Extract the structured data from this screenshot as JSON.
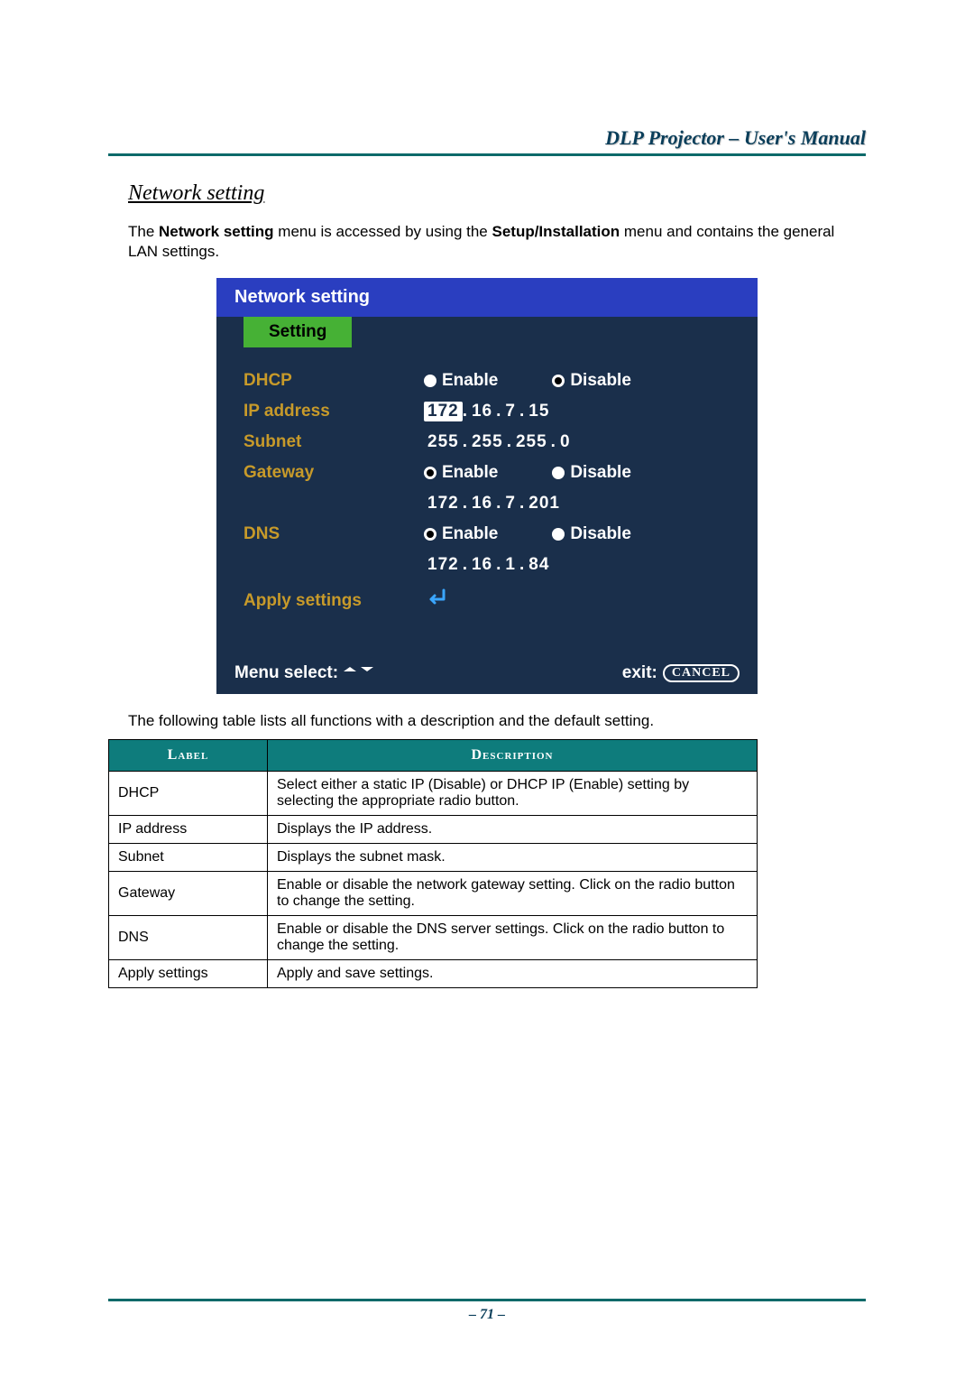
{
  "header": {
    "title": "DLP Projector – User's Manual"
  },
  "section": {
    "heading": "Network setting",
    "intro_pre": "The ",
    "intro_b1": "Network setting",
    "intro_mid": " menu is accessed by using the ",
    "intro_b2": "Setup/Installation",
    "intro_post": " menu and contains the general LAN settings."
  },
  "osd": {
    "title": "Network setting",
    "tab": "Setting",
    "rows": {
      "dhcp": {
        "label": "DHCP",
        "enable": "Enable",
        "disable": "Disable",
        "selected": "disable"
      },
      "ip": {
        "label": "IP address",
        "octets": [
          "172",
          "16",
          "7",
          "15"
        ],
        "highlight_index": 0
      },
      "subnet": {
        "label": "Subnet",
        "octets": [
          "255",
          "255",
          "255",
          "0"
        ]
      },
      "gateway": {
        "label": "Gateway",
        "enable": "Enable",
        "disable": "Disable",
        "selected": "enable",
        "octets": [
          "172",
          "16",
          "7",
          "201"
        ]
      },
      "dns": {
        "label": "DNS",
        "enable": "Enable",
        "disable": "Disable",
        "selected": "enable",
        "octets": [
          "172",
          "16",
          "1",
          "84"
        ]
      },
      "apply": {
        "label": "Apply settings"
      }
    },
    "footer": {
      "menu_select": "Menu select:",
      "exit": "exit:",
      "cancel": "CANCEL"
    }
  },
  "caption": "The following table lists all functions with a description and the default setting.",
  "table": {
    "headers": {
      "label": "Label",
      "description": "Description"
    },
    "rows": [
      {
        "label": "DHCP",
        "desc": "Select either a static IP (Disable) or DHCP IP (Enable) setting by selecting the appropriate radio button."
      },
      {
        "label": "IP address",
        "desc": "Displays the IP address."
      },
      {
        "label": "Subnet",
        "desc": "Displays the subnet mask."
      },
      {
        "label": "Gateway",
        "desc": "Enable or disable the network gateway setting. Click on the radio button to change the setting."
      },
      {
        "label": "DNS",
        "desc": "Enable or disable the DNS server settings. Click on the radio button to change the setting."
      },
      {
        "label": "Apply settings",
        "desc": "Apply and save settings."
      }
    ]
  },
  "page_number": "– 71 –"
}
